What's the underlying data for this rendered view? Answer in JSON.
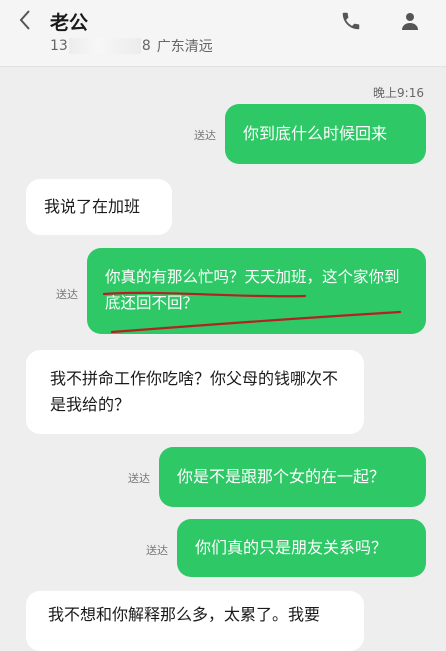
{
  "header": {
    "title": "老公",
    "number_prefix": "13",
    "number_suffix": "8",
    "location": "广东清远"
  },
  "timestamp": "晚上9:16",
  "messages": [
    {
      "from": "me",
      "text": "你到底什么时候回来",
      "status": "送达"
    },
    {
      "from": "them",
      "text": "我说了在加班"
    },
    {
      "from": "me",
      "text": "你真的有那么忙吗？天天加班，这个家你到底还回不回？",
      "status": "送达"
    },
    {
      "from": "them",
      "text": "我不拼命工作你吃啥？你父母的钱哪次不是我给的？"
    },
    {
      "from": "me",
      "text": "你是不是跟那个女的在一起？",
      "status": "送达"
    },
    {
      "from": "me",
      "text": "你们真的只是朋友关系吗？",
      "status": "送达"
    },
    {
      "from": "them",
      "text": "我不想和你解释那么多，太累了。我要"
    }
  ],
  "icons": {
    "back": "chevron-left-icon",
    "phone": "phone-icon",
    "contact": "person-icon"
  },
  "colors": {
    "sent_bubble": "#2ec866",
    "received_bubble": "#ffffff",
    "background": "#eeeeee",
    "annotation": "#b22222"
  }
}
